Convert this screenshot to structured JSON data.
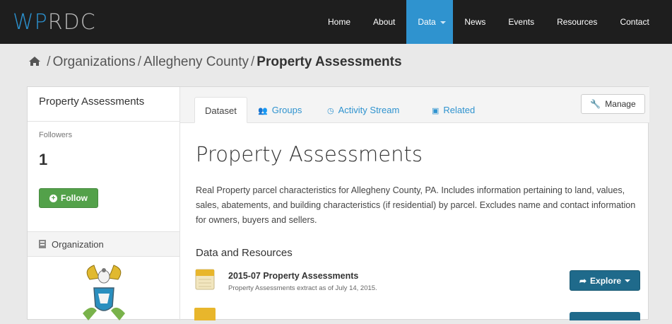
{
  "brand": {
    "logo_wp": "WP",
    "logo_rdc": "RDC",
    "accent": "#2f93cf",
    "wp_color": "#2b8fcc"
  },
  "nav": {
    "items": [
      {
        "label": "Home",
        "active": false
      },
      {
        "label": "About",
        "active": false
      },
      {
        "label": "Data",
        "active": true,
        "dropdown": true
      },
      {
        "label": "News",
        "active": false
      },
      {
        "label": "Events",
        "active": false
      },
      {
        "label": "Resources",
        "active": false
      },
      {
        "label": "Contact",
        "active": false
      }
    ]
  },
  "breadcrumb": {
    "home_icon": "home-icon",
    "sep": "/",
    "items": [
      "Organizations",
      "Allegheny County"
    ],
    "current": "Property Assessments"
  },
  "sidebar": {
    "title": "Property Assessments",
    "followers_label": "Followers",
    "followers_count": "1",
    "follow_label": "Follow",
    "organization_label": "Organization",
    "follow_color": "#53a14a"
  },
  "tabs": [
    {
      "label": "Dataset",
      "icon": "",
      "active": true
    },
    {
      "label": "Groups",
      "icon": "users-icon",
      "active": false
    },
    {
      "label": "Activity Stream",
      "icon": "clock-icon",
      "active": false
    },
    {
      "label": "Related",
      "icon": "picture-icon",
      "active": false
    }
  ],
  "manage_label": "Manage",
  "dataset": {
    "title": "Property Assessments",
    "notes": "Real Property parcel characteristics for Allegheny County, PA. Includes information pertaining to land, values, sales, abatements, and building characteristics (if residential) by parcel. Excludes name and contact information for owners, buyers and sellers."
  },
  "resources": {
    "heading": "Data and Resources",
    "items": [
      {
        "name": "2015-07 Property Assessments",
        "description": "Property Assessments extract as of July 14, 2015.",
        "explore_label": "Explore",
        "icon": "csv-file-icon"
      }
    ],
    "explore_color": "#1f6a8b"
  }
}
